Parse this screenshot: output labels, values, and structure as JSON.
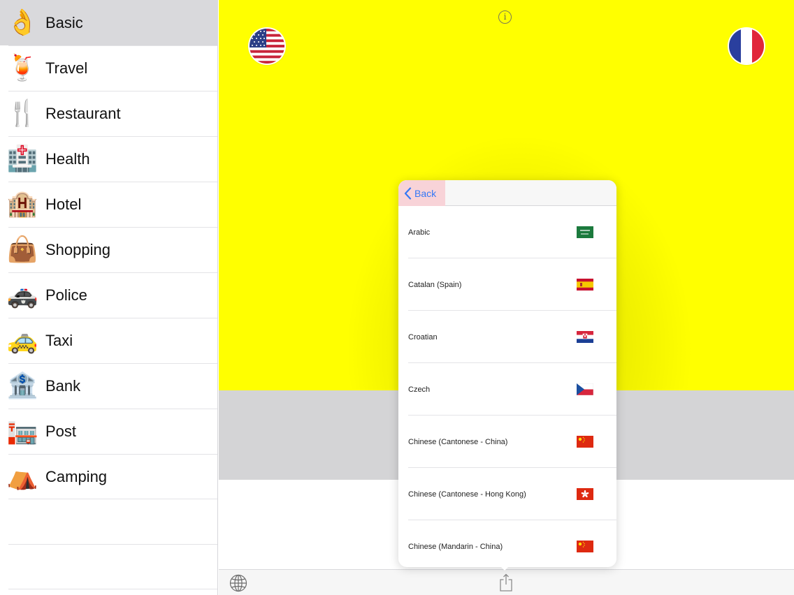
{
  "sidebar": {
    "items": [
      {
        "label": "Basic",
        "emoji": "👌"
      },
      {
        "label": "Travel",
        "emoji": "🍹"
      },
      {
        "label": "Restaurant",
        "emoji": "🍴"
      },
      {
        "label": "Health",
        "emoji": "🏥"
      },
      {
        "label": "Hotel",
        "emoji": "🏨"
      },
      {
        "label": "Shopping",
        "emoji": "👜"
      },
      {
        "label": "Police",
        "emoji": "🚓"
      },
      {
        "label": "Taxi",
        "emoji": "🚕"
      },
      {
        "label": "Bank",
        "emoji": "🏦"
      },
      {
        "label": "Post",
        "emoji": "🏣"
      },
      {
        "label": "Camping",
        "emoji": "⛺"
      }
    ],
    "selected_index": 0
  },
  "main": {
    "source_flag": "us-flag-icon",
    "target_flag": "france-flag-icon",
    "info_icon": "i",
    "panel_colors": {
      "top": "#ffff00",
      "middle": "#d4d4d6",
      "bottom": "#ffffff"
    }
  },
  "popover": {
    "back_label": "Back",
    "languages": [
      {
        "name": "Arabic",
        "flag": "saudi-arabia-flag-icon"
      },
      {
        "name": "Catalan (Spain)",
        "flag": "spain-flag-icon"
      },
      {
        "name": "Croatian",
        "flag": "croatia-flag-icon"
      },
      {
        "name": "Czech",
        "flag": "czech-flag-icon"
      },
      {
        "name": "Chinese (Cantonese - China)",
        "flag": "china-flag-icon"
      },
      {
        "name": "Chinese (Cantonese - Hong Kong)",
        "flag": "hong-kong-flag-icon"
      },
      {
        "name": "Chinese (Mandarin - China)",
        "flag": "china-flag-icon"
      }
    ]
  },
  "toolbar": {
    "left_icon": "globe-icon",
    "center_icon": "share-icon"
  },
  "colors": {
    "accent": "#3478f6",
    "back_highlight": "#f8d3d8",
    "selection": "#d9d9dc"
  }
}
